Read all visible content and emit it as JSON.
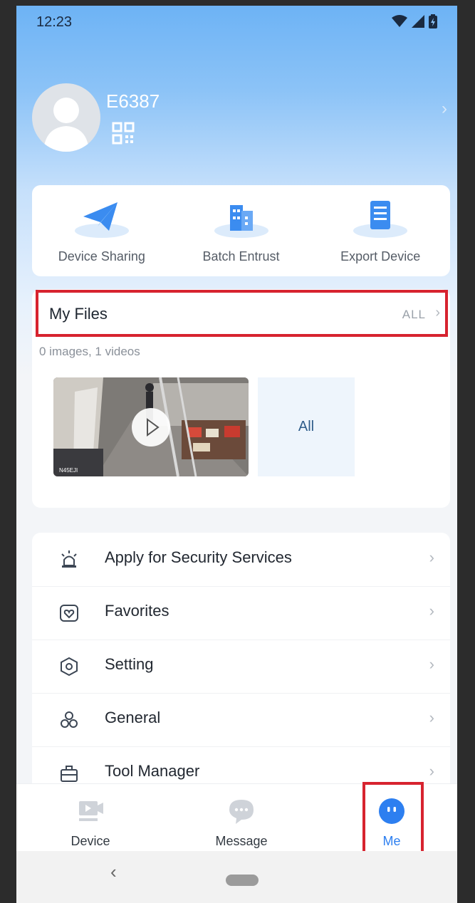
{
  "status": {
    "time": "12:23"
  },
  "profile": {
    "username": "E6387"
  },
  "quick_actions": [
    {
      "label": "Device Sharing",
      "icon": "paper-plane-icon"
    },
    {
      "label": "Batch Entrust",
      "icon": "building-icon"
    },
    {
      "label": "Export Device",
      "icon": "document-list-icon"
    }
  ],
  "files": {
    "title": "My Files",
    "all_label": "ALL",
    "count_text": "0 images, 1 videos",
    "thumb_caption": "N45EJI",
    "all_tile_label": "All"
  },
  "menu": [
    {
      "label": "Apply for Security Services",
      "icon": "alarm-light-icon"
    },
    {
      "label": "Favorites",
      "icon": "heart-icon"
    },
    {
      "label": "Setting",
      "icon": "hexagon-gear-icon"
    },
    {
      "label": "General",
      "icon": "three-circles-icon"
    },
    {
      "label": "Tool Manager",
      "icon": "toolbox-icon"
    }
  ],
  "tabs": [
    {
      "label": "Device",
      "icon": "camera-device-icon"
    },
    {
      "label": "Message",
      "icon": "chat-bubble-icon"
    },
    {
      "label": "Me",
      "icon": "me-face-icon",
      "active": true
    }
  ],
  "colors": {
    "accent": "#2d7ff0",
    "highlight": "#d7232f",
    "inactive_icon": "#cfd3d9"
  }
}
